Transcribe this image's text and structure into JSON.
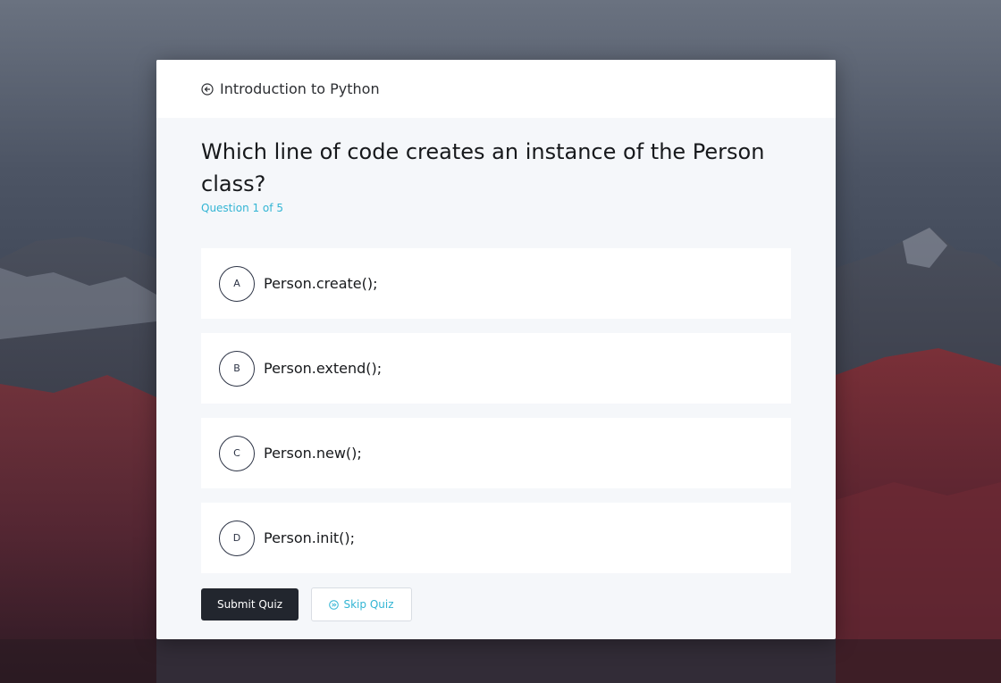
{
  "header": {
    "icon": "circle-arrow-icon",
    "title": "Introduction to Python"
  },
  "question": {
    "text": "Which line of code creates an instance of the Person class?",
    "progress": "Question 1 of 5"
  },
  "options": [
    {
      "letter": "A",
      "text": "Person.create();"
    },
    {
      "letter": "B",
      "text": "Person.extend();"
    },
    {
      "letter": "C",
      "text": "Person.new();"
    },
    {
      "letter": "D",
      "text": "Person.init();"
    }
  ],
  "actions": {
    "submit_label": "Submit Quiz",
    "skip_label": "Skip Quiz",
    "skip_icon": "skip-forward-icon"
  },
  "colors": {
    "accent": "#33b5d4",
    "primary_button": "#22262e",
    "card_background": "#f5f7fa"
  }
}
